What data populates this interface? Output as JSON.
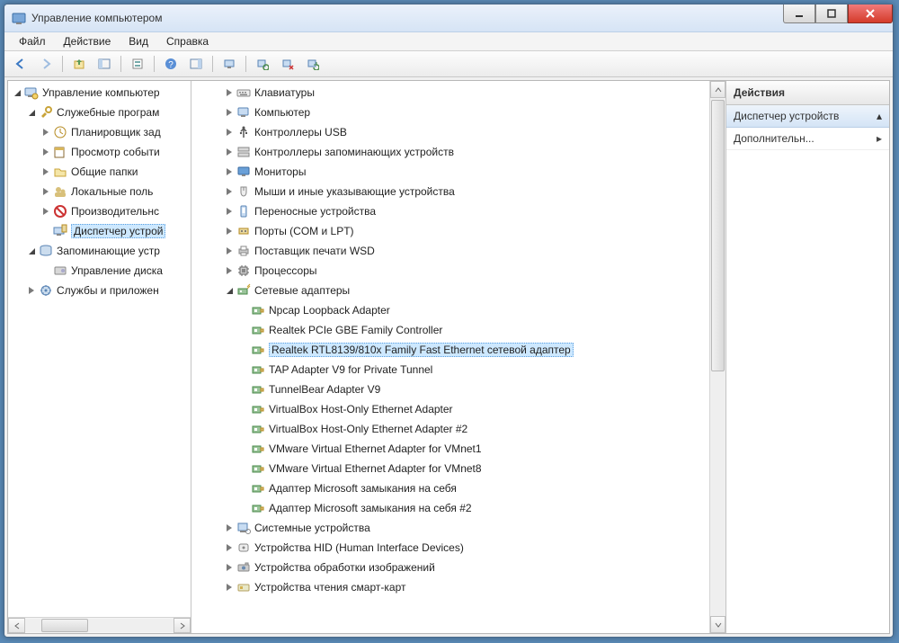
{
  "window": {
    "title": "Управление компьютером"
  },
  "menu": {
    "file": "Файл",
    "action": "Действие",
    "view": "Вид",
    "help": "Справка"
  },
  "left_tree": {
    "root": "Управление компьютер",
    "groups": [
      {
        "label": "Служебные програм",
        "children": [
          "Планировщик зад",
          "Просмотр событи",
          "Общие папки",
          "Локальные поль",
          "Производительнс",
          "Диспетчер устрой"
        ],
        "selected_index": 5
      },
      {
        "label": "Запоминающие устр",
        "children": [
          "Управление диска"
        ]
      },
      {
        "label": "Службы и приложен",
        "children": []
      }
    ]
  },
  "center_tree": {
    "collapsed_categories": [
      "Клавиатуры",
      "Компьютер",
      "Контроллеры USB",
      "Контроллеры запоминающих устройств",
      "Мониторы",
      "Мыши и иные указывающие устройства",
      "Переносные устройства",
      "Порты (COM и LPT)",
      "Поставщик печати WSD",
      "Процессоры"
    ],
    "expanded_category": "Сетевые адаптеры",
    "adapters": [
      "Npcap Loopback Adapter",
      "Realtek PCIe GBE Family Controller",
      "Realtek RTL8139/810x Family Fast Ethernet сетевой адаптер",
      "TAP Adapter V9 for Private Tunnel",
      "TunnelBear Adapter V9",
      "VirtualBox Host-Only Ethernet Adapter",
      "VirtualBox Host-Only Ethernet Adapter #2",
      "VMware Virtual Ethernet Adapter for VMnet1",
      "VMware Virtual Ethernet Adapter for VMnet8",
      "Адаптер Microsoft замыкания на себя",
      "Адаптер Microsoft замыкания на себя #2"
    ],
    "adapter_selected_index": 2,
    "trailing_categories": [
      "Системные устройства",
      "Устройства HID (Human Interface Devices)",
      "Устройства обработки изображений",
      "Устройства чтения смарт-карт"
    ]
  },
  "actions": {
    "header": "Действия",
    "section": "Диспетчер устройств",
    "link": "Дополнительн..."
  }
}
